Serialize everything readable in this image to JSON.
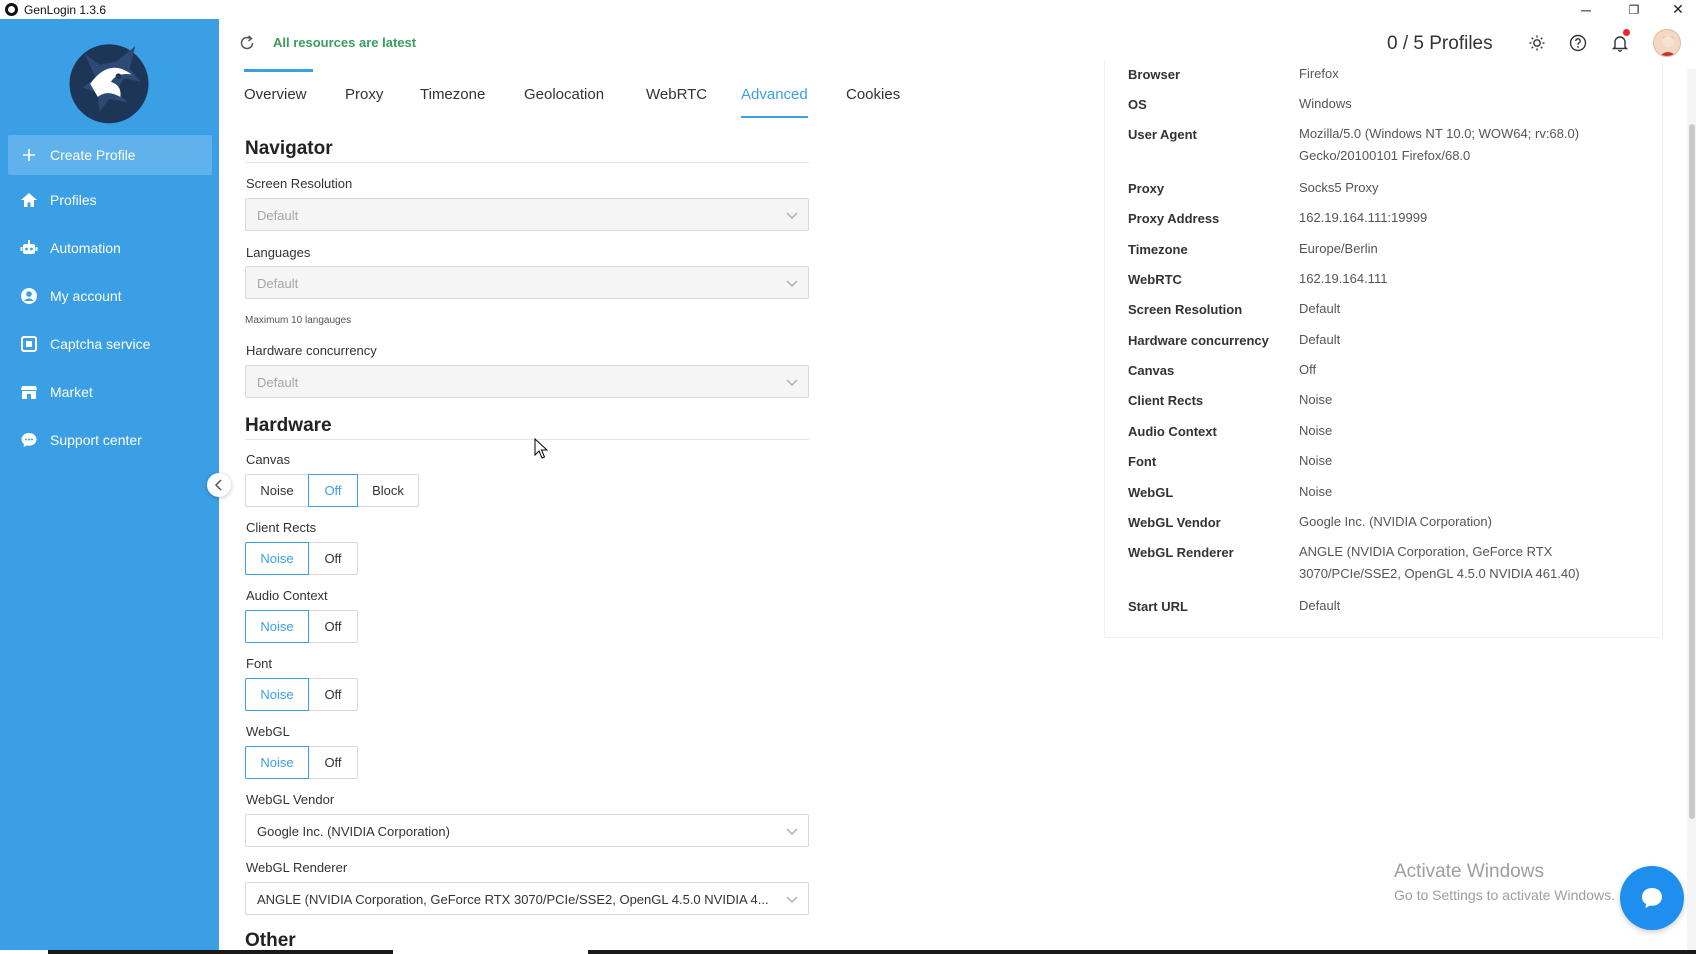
{
  "window": {
    "title": "GenLogin 1.3.6",
    "minimize_glyph": "─",
    "restore_glyph": "❐",
    "close_glyph": "✕"
  },
  "sidebar": {
    "items": [
      {
        "label": "Create Profile",
        "icon": "plus-icon"
      },
      {
        "label": "Profiles",
        "icon": "home-icon"
      },
      {
        "label": "Automation",
        "icon": "robot-icon"
      },
      {
        "label": "My account",
        "icon": "user-icon"
      },
      {
        "label": "Captcha service",
        "icon": "captcha-icon"
      },
      {
        "label": "Market",
        "icon": "market-icon"
      },
      {
        "label": "Support center",
        "icon": "chat-icon"
      }
    ],
    "accent": "#3b9fe5"
  },
  "header": {
    "status": "All resources are latest",
    "profiles_count": "0 / 5 Profiles"
  },
  "tabs": [
    {
      "label": "Overview"
    },
    {
      "label": "Proxy"
    },
    {
      "label": "Timezone"
    },
    {
      "label": "Geolocation"
    },
    {
      "label": "WebRTC"
    },
    {
      "label": "Advanced"
    },
    {
      "label": "Cookies"
    }
  ],
  "form": {
    "navigator_title": "Navigator",
    "screen_resolution": {
      "label": "Screen Resolution",
      "value": "Default"
    },
    "languages": {
      "label": "Languages",
      "value": "Default",
      "hint": "Maximum 10 langauges"
    },
    "hardware_concurrency": {
      "label": "Hardware concurrency",
      "value": "Default"
    },
    "hardware_title": "Hardware",
    "canvas": {
      "label": "Canvas",
      "options": [
        "Noise",
        "Off",
        "Block"
      ],
      "selected": "Off"
    },
    "client_rects": {
      "label": "Client Rects",
      "options": [
        "Noise",
        "Off"
      ],
      "selected": "Noise"
    },
    "audio_context": {
      "label": "Audio Context",
      "options": [
        "Noise",
        "Off"
      ],
      "selected": "Noise"
    },
    "font": {
      "label": "Font",
      "options": [
        "Noise",
        "Off"
      ],
      "selected": "Noise"
    },
    "webgl": {
      "label": "WebGL",
      "options": [
        "Noise",
        "Off"
      ],
      "selected": "Noise"
    },
    "webgl_vendor": {
      "label": "WebGL Vendor",
      "value": "Google Inc. (NVIDIA Corporation)"
    },
    "webgl_renderer": {
      "label": "WebGL Renderer",
      "value": "ANGLE (NVIDIA Corporation, GeForce RTX 3070/PCIe/SSE2, OpenGL 4.5.0 NVIDIA 4..."
    },
    "other_title": "Other"
  },
  "summary": [
    {
      "key": "Browser",
      "value": "Firefox"
    },
    {
      "key": "OS",
      "value": "Windows"
    },
    {
      "key": "User Agent",
      "value": "Mozilla/5.0 (Windows NT 10.0; WOW64; rv:68.0) Gecko/20100101 Firefox/68.0"
    },
    {
      "key": "Proxy",
      "value": "Socks5 Proxy"
    },
    {
      "key": "Proxy Address",
      "value": "162.19.164.111:19999"
    },
    {
      "key": "Timezone",
      "value": "Europe/Berlin"
    },
    {
      "key": "WebRTC",
      "value": "162.19.164.111"
    },
    {
      "key": "Screen Resolution",
      "value": "Default"
    },
    {
      "key": "Hardware concurrency",
      "value": "Default"
    },
    {
      "key": "Canvas",
      "value": "Off"
    },
    {
      "key": "Client Rects",
      "value": "Noise"
    },
    {
      "key": "Audio Context",
      "value": "Noise"
    },
    {
      "key": "Font",
      "value": "Noise"
    },
    {
      "key": "WebGL",
      "value": "Noise"
    },
    {
      "key": "WebGL Vendor",
      "value": "Google Inc. (NVIDIA Corporation)"
    },
    {
      "key": "WebGL Renderer",
      "value": "ANGLE (NVIDIA Corporation, GeForce RTX 3070/PCIe/SSE2, OpenGL 4.5.0 NVIDIA 461.40)"
    },
    {
      "key": "Start URL",
      "value": "Default"
    }
  ],
  "watermark": {
    "line1": "Activate Windows",
    "line2": "Go to Settings to activate Windows."
  }
}
